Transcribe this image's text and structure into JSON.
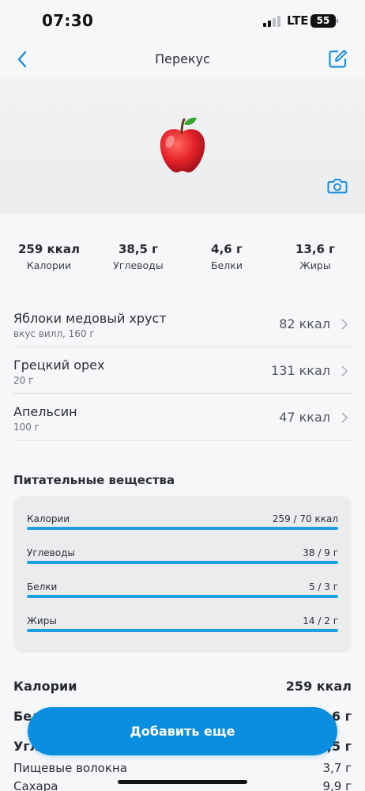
{
  "status_bar": {
    "time": "07:30",
    "network": "LTE",
    "battery": "55"
  },
  "nav": {
    "title": "Перекус"
  },
  "hero": {
    "image": "apple-emoji"
  },
  "summary": [
    {
      "value": "259 ккал",
      "label": "Калории"
    },
    {
      "value": "38,5 г",
      "label": "Углеводы"
    },
    {
      "value": "4,6 г",
      "label": "Белки"
    },
    {
      "value": "13,6 г",
      "label": "Жиры"
    }
  ],
  "foods": [
    {
      "name": "Яблоки медовый хруст",
      "detail": "вкус вилл, 160 г",
      "kcal": "82 ккал"
    },
    {
      "name": "Грецкий орех",
      "detail": "20 г",
      "kcal": "131 ккал"
    },
    {
      "name": "Апельсин",
      "detail": "100 г",
      "kcal": "47 ккал"
    }
  ],
  "nutrients": {
    "title": "Питательные вещества",
    "rows": [
      {
        "label": "Калории",
        "value": "259 / 70 ккал",
        "fill": 1.0
      },
      {
        "label": "Углеводы",
        "value": "38 / 9 г",
        "fill": 1.0
      },
      {
        "label": "Белки",
        "value": "5 / 3 г",
        "fill": 1.0
      },
      {
        "label": "Жиры",
        "value": "14 / 2 г",
        "fill": 1.0
      }
    ]
  },
  "totals": [
    {
      "label": "Калории",
      "value": "259 ккал"
    },
    {
      "label": "Белки",
      "value": "4,6 г"
    },
    {
      "label": "Углеводы",
      "value": "38,5 г"
    },
    {
      "label": "Пищевые волокна",
      "value": "3,7 г"
    },
    {
      "label": "Сахара",
      "value": "9,9 г"
    }
  ],
  "add_button": {
    "label": "Добавить еще"
  },
  "colors": {
    "accent": "#0a8fe0",
    "progress": "#1ea0e3"
  }
}
